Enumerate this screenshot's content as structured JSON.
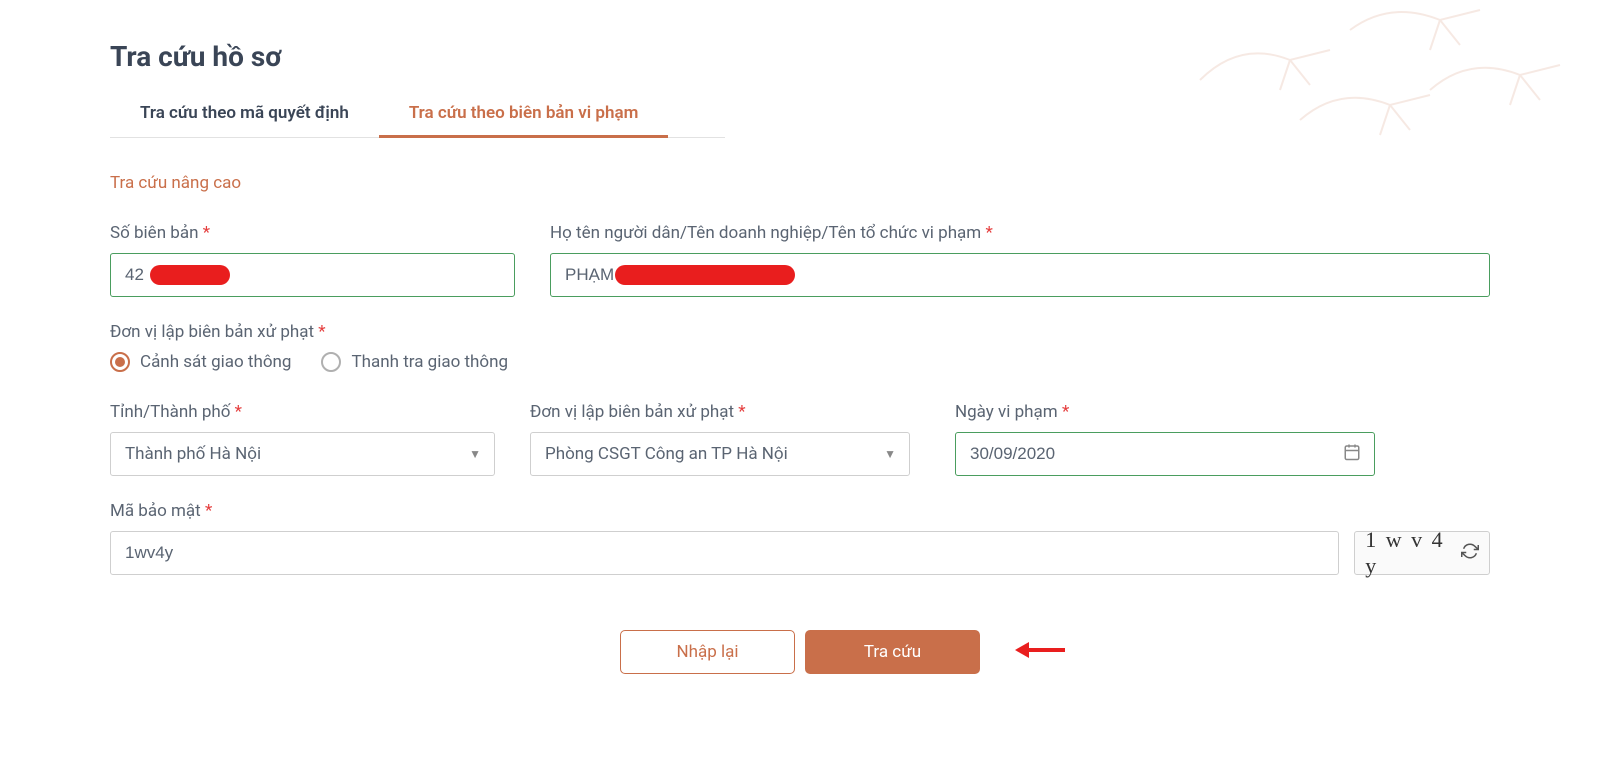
{
  "page_title": "Tra cứu hồ sơ",
  "tabs": [
    {
      "label": "Tra cứu theo mã quyết định",
      "active": false
    },
    {
      "label": "Tra cứu theo biên bản vi phạm",
      "active": true
    }
  ],
  "advanced_search_label": "Tra cứu nâng cao",
  "fields": {
    "record_number": {
      "label": "Số biên bản",
      "value": "42"
    },
    "person_name": {
      "label": "Họ tên người dân/Tên doanh nghiệp/Tên tổ chức vi phạm",
      "value": "PHẠM"
    },
    "issuing_unit_section": {
      "label": "Đơn vị lập biên bản xử phạt"
    },
    "radio_options": [
      {
        "label": "Cảnh sát giao thông",
        "checked": true
      },
      {
        "label": "Thanh tra giao thông",
        "checked": false
      }
    ],
    "city": {
      "label": "Tỉnh/Thành phố",
      "value": "Thành phố Hà Nội"
    },
    "unit": {
      "label": "Đơn vị lập biên bản xử phạt",
      "value": "Phòng CSGT Công an TP Hà Nội"
    },
    "violation_date": {
      "label": "Ngày vi phạm",
      "value": "30/09/2020"
    },
    "captcha": {
      "label": "Mã bảo mật",
      "value": "1wv4y",
      "display": "1 w v 4 y"
    }
  },
  "buttons": {
    "reset": "Nhập lại",
    "search": "Tra cứu"
  }
}
